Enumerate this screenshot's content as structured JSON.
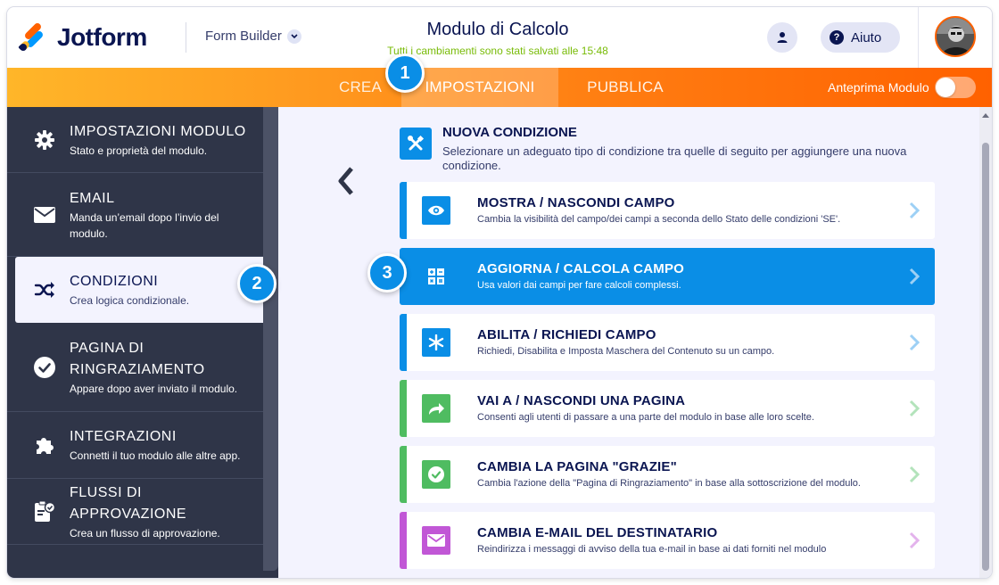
{
  "header": {
    "logo_text": "Jotform",
    "builder_label": "Form Builder",
    "form_title": "Modulo di Calcolo",
    "save_status": "Tutti i cambiamenti sono stati salvati alle 15:48",
    "help_label": "Aiuto"
  },
  "nav": {
    "tabs": [
      "CREA",
      "IMPOSTAZIONI",
      "PUBBLICA"
    ],
    "active_tab": "IMPOSTAZIONI",
    "preview_label": "Anteprima Modulo",
    "preview_enabled": false
  },
  "steps": [
    "1",
    "2",
    "3"
  ],
  "sidebar": {
    "items": [
      {
        "title": "IMPOSTAZIONI MODULO",
        "desc": "Stato e proprietà del modulo.",
        "icon": "gear-icon"
      },
      {
        "title": "EMAIL",
        "desc": "Manda un’email dopo l’invio del modulo.",
        "icon": "envelope-icon"
      },
      {
        "title": "CONDIZIONI",
        "desc": "Crea logica condizionale.",
        "icon": "shuffle-icon",
        "active": true
      },
      {
        "title": "PAGINA DI RINGRAZIAMENTO",
        "desc": "Appare dopo aver inviato il modulo.",
        "icon": "check-circle-icon"
      },
      {
        "title": "INTEGRAZIONI",
        "desc": "Connetti il tuo modulo alle altre app.",
        "icon": "puzzle-icon"
      },
      {
        "title": "FLUSSI DI APPROVAZIONE",
        "desc": "Crea un flusso di approvazione.",
        "icon": "approval-icon"
      }
    ]
  },
  "main": {
    "new_condition": {
      "title": "NUOVA CONDIZIONE",
      "desc": "Selezionare un adeguato tipo di condizione tra quelle di seguito per aggiungere una nuova condizione.",
      "icon": "tools-icon"
    },
    "cards": [
      {
        "title": "MOSTRA / NASCONDI CAMPO",
        "desc": "Cambia la visibilità del campo/dei campi a seconda dello Stato delle condizioni 'SE'.",
        "icon": "eye-icon",
        "color": "#0a8ee6"
      },
      {
        "title": "AGGIORNA / CALCOLA CAMPO",
        "desc": "Usa valori dai campi per fare calcoli complessi.",
        "icon": "calculator-icon",
        "color": "#0a8ee6",
        "active": true
      },
      {
        "title": "ABILITA / RICHIEDI CAMPO",
        "desc": "Richiedi, Disabilita e Imposta Maschera del Contenuto su un campo.",
        "icon": "asterisk-icon",
        "color": "#0a8ee6"
      },
      {
        "title": "VAI A / NASCONDI UNA PAGINA",
        "desc": "Consenti agli utenti di passare a una parte del modulo in base alle loro scelte.",
        "icon": "share-arrow-icon",
        "color": "#4fbc61"
      },
      {
        "title": "CAMBIA LA PAGINA \"GRAZIE\"",
        "desc": "Cambia l'azione della \"Pagina di Ringraziamento\" in base alla sottoscrizione del modulo.",
        "icon": "check-circle-icon",
        "color": "#4fbc61"
      },
      {
        "title": "CAMBIA E-MAIL DEL DESTINATARIO",
        "desc": "Reindirizza i messaggi di avviso della tua e-mail in base ai dati forniti nel modulo",
        "icon": "envelope-icon",
        "color": "#c157d6"
      }
    ]
  }
}
